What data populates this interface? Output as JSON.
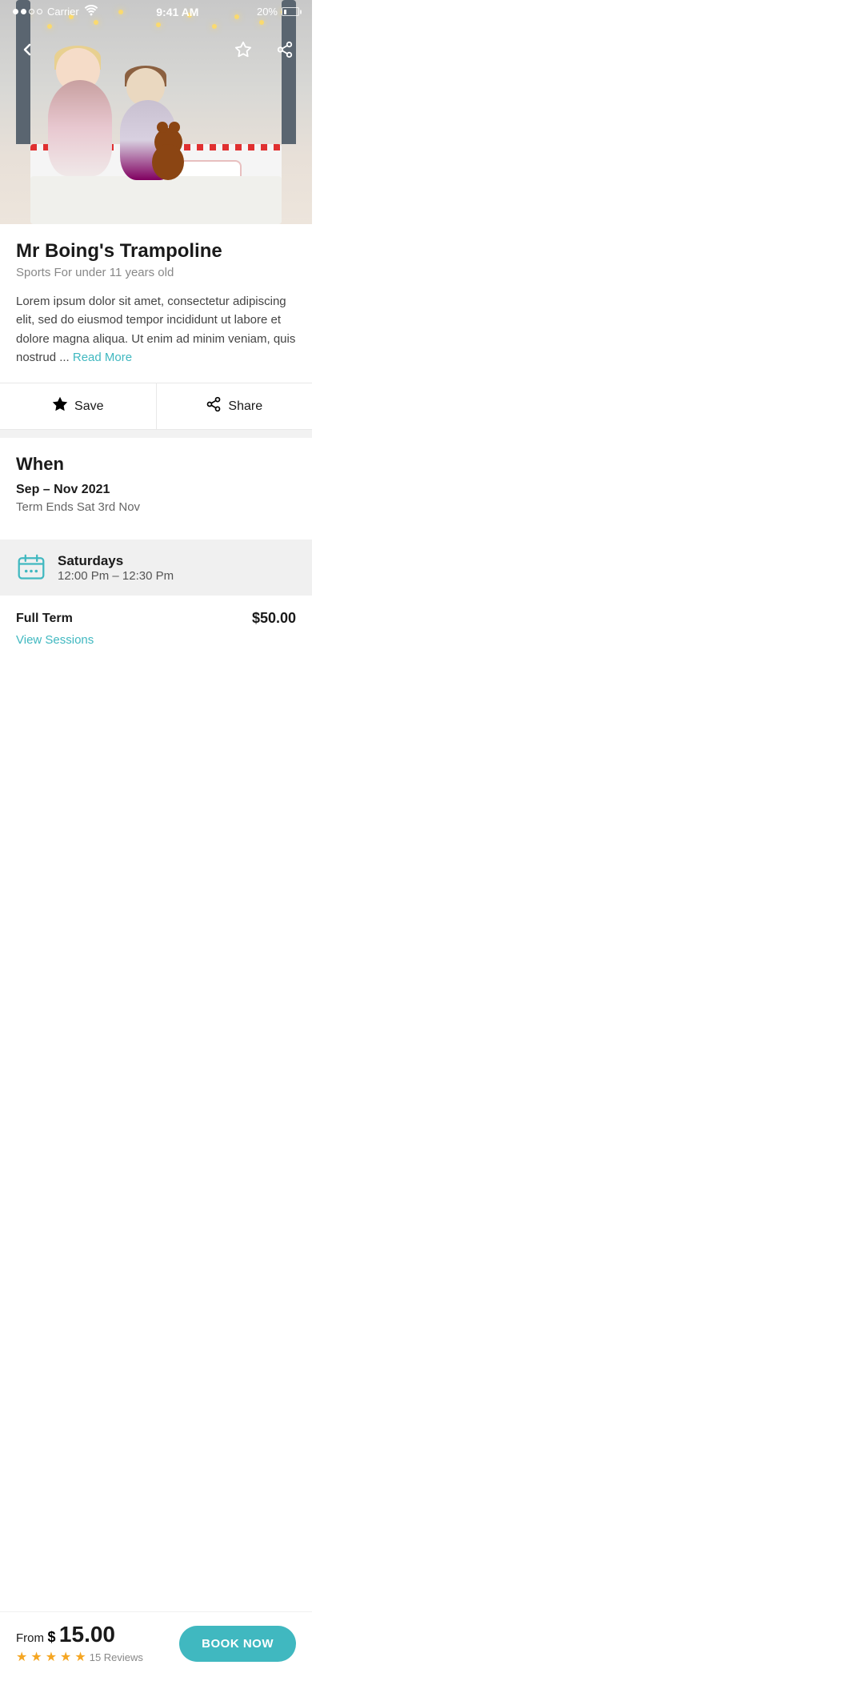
{
  "status": {
    "carrier": "Carrier",
    "time": "9:41 AM",
    "battery": "20%"
  },
  "hero": {
    "alt": "Two children on a bed with fairy lights"
  },
  "nav": {
    "back_label": "‹",
    "save_label": "★",
    "share_label": "⤴"
  },
  "venue": {
    "title": "Mr Boing's Trampoline",
    "subtitle": "Sports For under 11 years old",
    "description": "Lorem ipsum dolor sit amet, consectetur adipiscing elit, sed do eiusmod tempor incididunt ut labore et dolore magna aliqua. Ut enim ad minim veniam, quis nostrud ...",
    "read_more_label": "Read More"
  },
  "actions": {
    "save_label": "Save",
    "share_label": "Share"
  },
  "when": {
    "section_title": "When",
    "date_range": "Sep – Nov 2021",
    "term_end": "Term Ends Sat 3rd Nov",
    "schedule": {
      "day": "Saturdays",
      "time": "12:00 Pm – 12:30 Pm"
    }
  },
  "pricing": {
    "label": "Full Term",
    "amount": "$50.00",
    "view_sessions_label": "View Sessions"
  },
  "bottom": {
    "from_label": "From",
    "currency": "$",
    "price": "15.00",
    "stars": 5,
    "reviews_count": "15 Reviews",
    "book_label": "BOOK NOW"
  },
  "colors": {
    "accent": "#40b8c0",
    "star": "#f5a623",
    "text_primary": "#1a1a1a",
    "text_secondary": "#888"
  }
}
